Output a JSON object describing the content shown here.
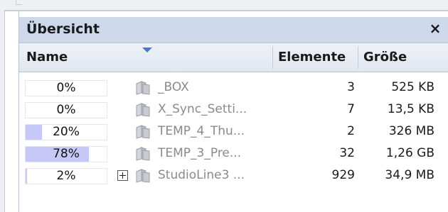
{
  "panel": {
    "title": "Übersicht",
    "close_label": "×"
  },
  "columns": {
    "name": "Name",
    "elements": "Elemente",
    "size": "Größe"
  },
  "rows": [
    {
      "percent_label": "0%",
      "percent": 0,
      "name": "_BOX",
      "elements": "3",
      "size": "525 KB",
      "expandable": false
    },
    {
      "percent_label": "0%",
      "percent": 0,
      "name": "X_Sync_Setti...",
      "elements": "7",
      "size": "13,5 KB",
      "expandable": false
    },
    {
      "percent_label": "20%",
      "percent": 20,
      "name": "TEMP_4_Thu...",
      "elements": "2",
      "size": "326 MB",
      "expandable": false
    },
    {
      "percent_label": "78%",
      "percent": 78,
      "name": "TEMP_3_Pre...",
      "elements": "32",
      "size": "1,26 GB",
      "expandable": false
    },
    {
      "percent_label": "2%",
      "percent": 2,
      "name": "StudioLine3 ...",
      "elements": "929",
      "size": "34,9 MB",
      "expandable": true
    }
  ],
  "colors": {
    "title_bar": "#ced8eb",
    "progress_fill": "#c7c8f8",
    "folder": "#b5b8bf",
    "sort_arrow": "#4a78c8"
  },
  "icons": {
    "folder": "folder-icon",
    "expander": "plus-box-icon",
    "sort": "sort-down-arrow-icon",
    "close": "close-icon"
  }
}
